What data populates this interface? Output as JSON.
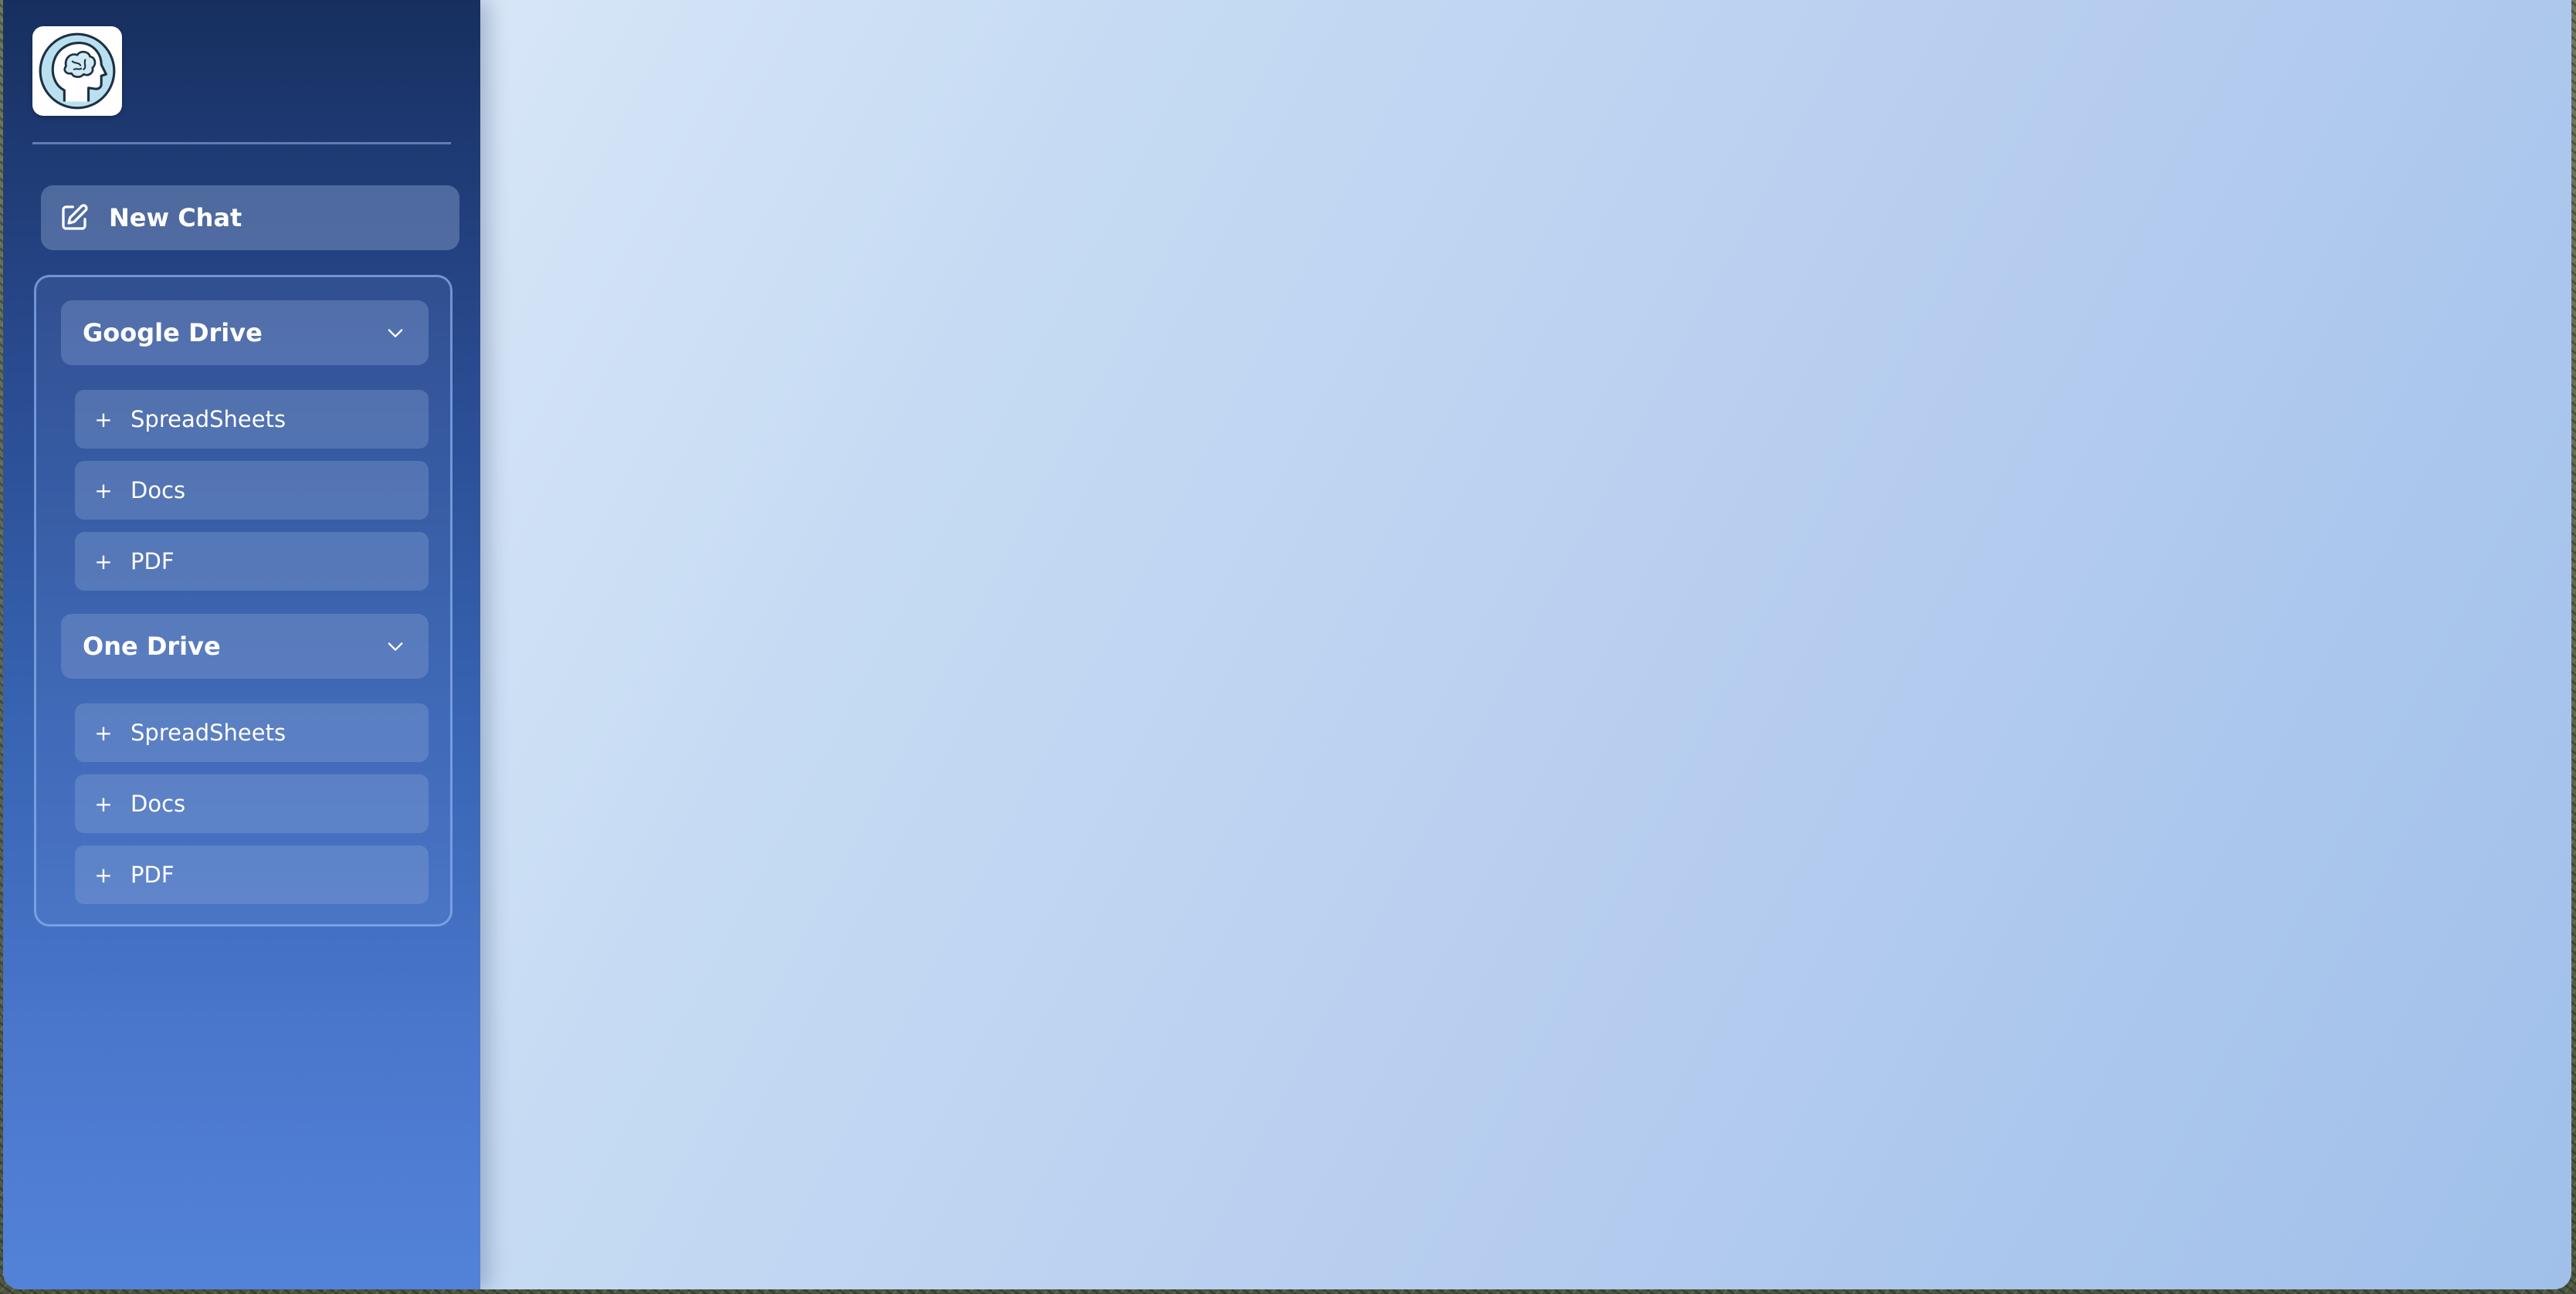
{
  "app": {
    "logo_icon": "brain-head-icon"
  },
  "sidebar": {
    "new_chat": {
      "label": "New Chat",
      "icon": "edit-square-icon"
    },
    "groups": [
      {
        "title": "Google Drive",
        "expanded": true,
        "items": [
          {
            "label": "SpreadSheets"
          },
          {
            "label": "Docs"
          },
          {
            "label": "PDF"
          }
        ]
      },
      {
        "title": "One Drive",
        "expanded": true,
        "items": [
          {
            "label": "SpreadSheets"
          },
          {
            "label": "Docs"
          },
          {
            "label": "PDF"
          }
        ]
      }
    ]
  },
  "colors": {
    "sidebar_top": "#172f5f",
    "sidebar_bottom": "#5283d9",
    "main_background_light": "#e4eefb",
    "main_background_dark": "#a0c0ea",
    "text": "#ffffff"
  }
}
